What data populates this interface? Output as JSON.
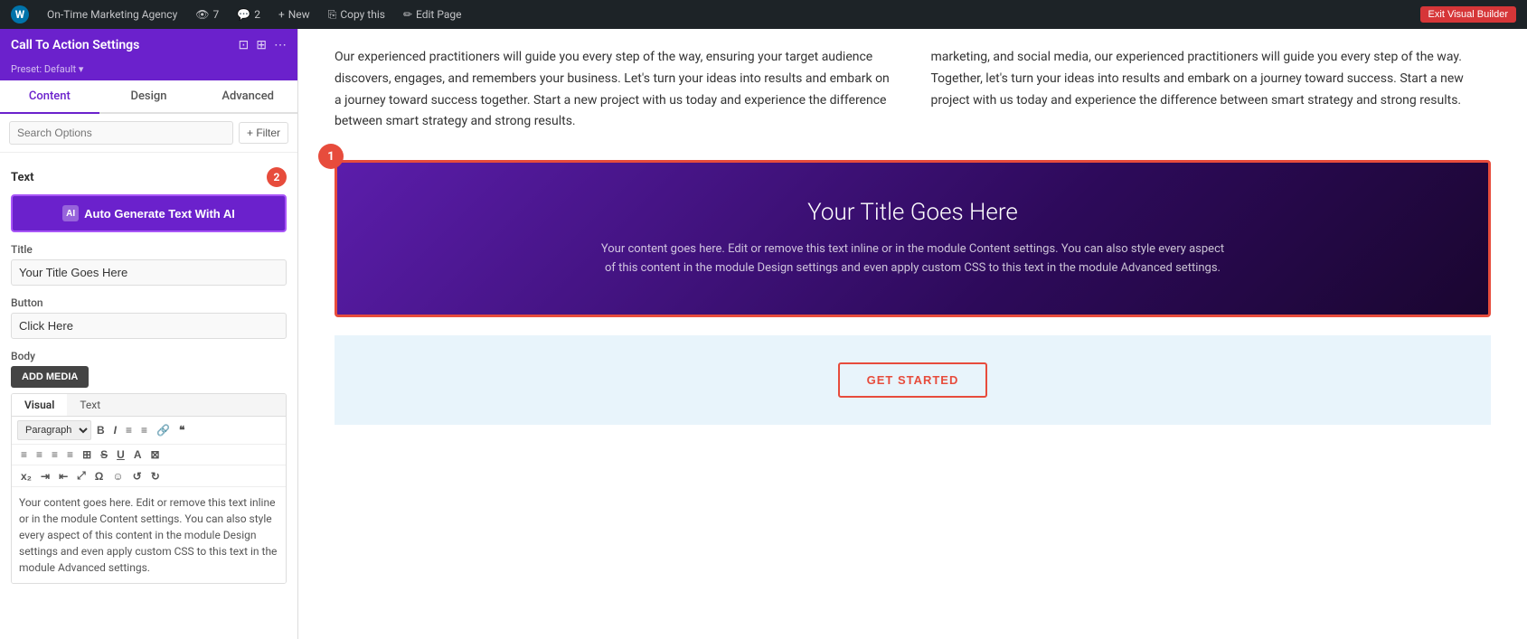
{
  "adminBar": {
    "wpLabel": "W",
    "agencyName": "On-Time Marketing Agency",
    "eyeCount": "7",
    "commentCount": "2",
    "newLabel": "New",
    "copyLabel": "Copy this",
    "editLabel": "Edit Page",
    "exitLabel": "Exit Visual Builder"
  },
  "panel": {
    "title": "Call To Action Settings",
    "preset": "Preset: Default ▾",
    "tabs": [
      "Content",
      "Design",
      "Advanced"
    ],
    "activeTab": "Content",
    "searchPlaceholder": "Search Options",
    "filterLabel": "+ Filter"
  },
  "textSection": {
    "label": "Text",
    "badge": "2",
    "aiButtonLabel": "Auto Generate Text With AI",
    "aiIconLabel": "AI"
  },
  "titleField": {
    "label": "Title",
    "value": "Your Title Goes Here"
  },
  "buttonField": {
    "label": "Button",
    "value": "Click Here"
  },
  "bodySection": {
    "label": "Body",
    "addMediaLabel": "ADD MEDIA",
    "tabs": [
      "Visual",
      "Text"
    ],
    "activeTab": "Visual",
    "paragraphOption": "Paragraph",
    "content": "Your content goes here. Edit or remove this text inline or in the module Content settings. You can also style every aspect of this content in the module Design settings and even apply custom CSS to this text in the module Advanced settings."
  },
  "toolbar": {
    "bold": "B",
    "italic": "I",
    "ul": "≡",
    "ol": "≡",
    "link": "🔗",
    "quote": "❝",
    "alignLeft": "≡",
    "alignCenter": "≡",
    "alignRight": "≡",
    "justify": "≡",
    "table": "⊞",
    "strikethrough": "S",
    "underline": "U",
    "colorA": "A",
    "eraser": "⊠",
    "italic2": "I",
    "indent": "⇥",
    "outdent": "⇤",
    "expand": "⤢",
    "omega": "Ω",
    "emoji": "☺",
    "undo": "↺",
    "redo": "↻"
  },
  "mainContent": {
    "leftCol": "Our experienced practitioners will guide you every step of the way, ensuring your target audience discovers, engages, and remembers your business. Let's turn your ideas into results and embark on a journey toward success together. Start a new project with us today and experience the difference between smart strategy and strong results.",
    "rightCol": "marketing, and social media, our experienced practitioners will guide you every step of the way. Together, let's turn your ideas into results and embark on a journey toward success. Start a new project with us today and experience the difference between smart strategy and strong results.",
    "ctaBadge": "1",
    "ctaTitle": "Your Title Goes Here",
    "ctaBody": "Your content goes here. Edit or remove this text inline or in the module Content settings. You can also style every aspect of this content in the module Design settings and even apply custom CSS to this text in the module Advanced settings.",
    "getStartedLabel": "GET STARTED"
  }
}
